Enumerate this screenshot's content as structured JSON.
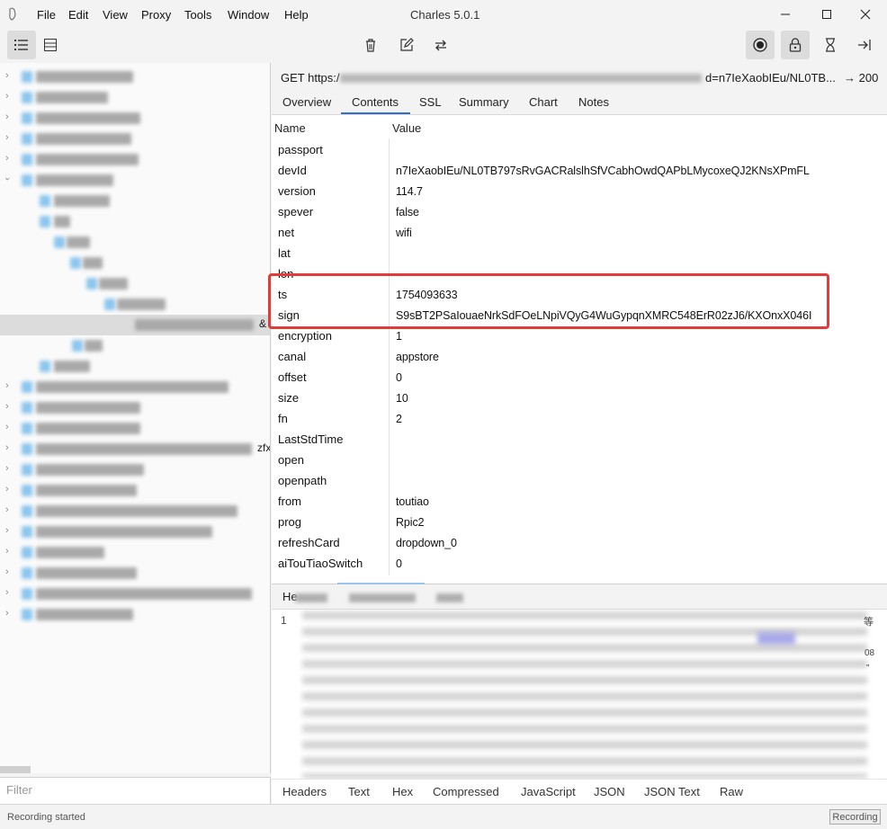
{
  "window": {
    "title": "Charles 5.0.1",
    "menu": [
      "File",
      "Edit",
      "View",
      "Proxy",
      "Tools",
      "Window",
      "Help"
    ],
    "controls": [
      "minimize-icon",
      "maximize-icon",
      "close-icon"
    ]
  },
  "toolbar": {
    "left_icons": [
      "structure-view-icon",
      "sequence-view-icon"
    ],
    "center_icons": [
      "trash-icon",
      "edit-icon",
      "repeat-icon"
    ],
    "right_icons": [
      "record-icon",
      "lock-icon",
      "throttle-icon",
      "step-icon"
    ]
  },
  "tree": {
    "fragments": {
      "row12": "&",
      "row18": "zfx"
    }
  },
  "request": {
    "method_url": "GET https:/",
    "url_tail": "d=n7IeXaobIEu/NL0TB...",
    "status": "→ 200"
  },
  "tabs": [
    "Overview",
    "Contents",
    "SSL",
    "Summary",
    "Chart",
    "Notes"
  ],
  "table": {
    "headers": {
      "name": "Name",
      "value": "Value"
    },
    "rows": [
      {
        "name": "passport",
        "value": ""
      },
      {
        "name": "devId",
        "value": "n7IeXaobIEu/NL0TB797sRvGACRalslhSfVCabhOwdQAPbLMycoxeQJ2KNsXPmFL"
      },
      {
        "name": "version",
        "value": "114.7"
      },
      {
        "name": "spever",
        "value": "false"
      },
      {
        "name": "net",
        "value": "wifi"
      },
      {
        "name": "lat",
        "value": ""
      },
      {
        "name": "lon",
        "value": ""
      },
      {
        "name": "ts",
        "value": "1754093633"
      },
      {
        "name": "sign",
        "value": "S9sBT2PSaIouaeNrkSdFOeLNpiVQyG4WuGypqnXMRC548ErR02zJ6/KXOnxX046I"
      },
      {
        "name": "encryption",
        "value": "1"
      },
      {
        "name": "canal",
        "value": "appstore"
      },
      {
        "name": "offset",
        "value": "0"
      },
      {
        "name": "size",
        "value": "10"
      },
      {
        "name": "fn",
        "value": "2"
      },
      {
        "name": "LastStdTime",
        "value": ""
      },
      {
        "name": "open",
        "value": ""
      },
      {
        "name": "openpath",
        "value": ""
      },
      {
        "name": "from",
        "value": "toutiao"
      },
      {
        "name": "prog",
        "value": "Rpic2"
      },
      {
        "name": "refreshCard",
        "value": "dropdown_0"
      },
      {
        "name": "aiTouTiaoSwitch",
        "value": "0"
      }
    ]
  },
  "bottom_panel": {
    "first_tab": "He",
    "line_number": "1",
    "side_glyphs": [
      "等",
      "08",
      "”"
    ],
    "tabs": [
      "Headers",
      "Text",
      "Hex",
      "Compressed",
      "JavaScript",
      "JSON",
      "JSON Text",
      "Raw"
    ]
  },
  "filter": {
    "placeholder": "Filter"
  },
  "status": {
    "text": "Recording started",
    "badge": "Recording"
  },
  "colors": {
    "highlight": "#e23b3b",
    "accent": "#2e6fd1",
    "blur_icon": "#8cc6ef"
  }
}
